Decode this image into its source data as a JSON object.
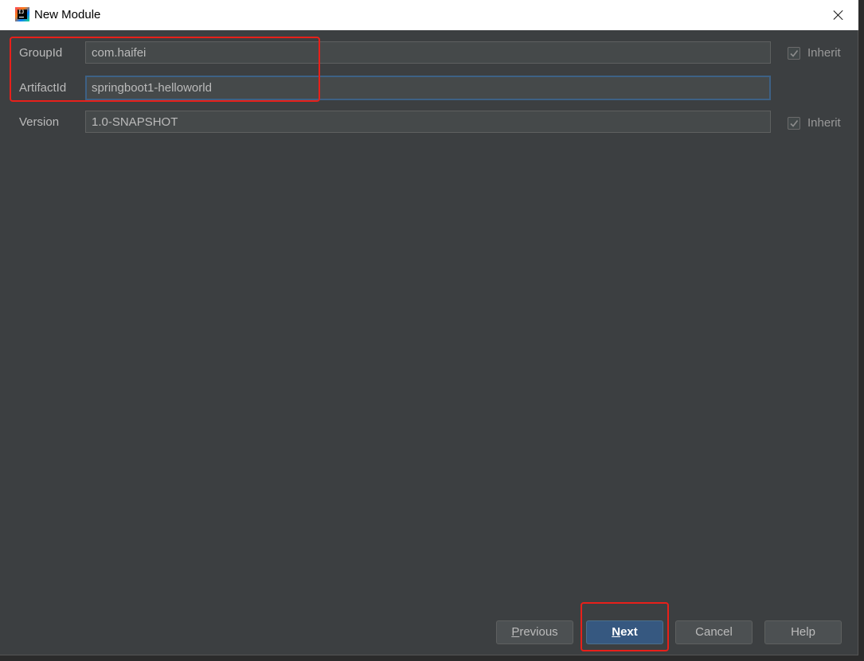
{
  "window": {
    "title": "New Module"
  },
  "form": {
    "group_id": {
      "label": "GroupId",
      "value": "com.haifei",
      "inherit_label": "Inherit",
      "inherit_checked": true
    },
    "artifact_id": {
      "label": "ArtifactId",
      "value": "springboot1-helloworld"
    },
    "version": {
      "label": "Version",
      "value": "1.0-SNAPSHOT",
      "inherit_label": "Inherit",
      "inherit_checked": true
    }
  },
  "buttons": {
    "previous": {
      "mnemonic": "P",
      "rest": "revious"
    },
    "next": {
      "mnemonic": "N",
      "rest": "ext"
    },
    "cancel": "Cancel",
    "help": "Help"
  },
  "colors": {
    "background": "#3c3f41",
    "field_bg": "#45494a",
    "primary_button": "#365880",
    "highlight": "#e8201a"
  }
}
